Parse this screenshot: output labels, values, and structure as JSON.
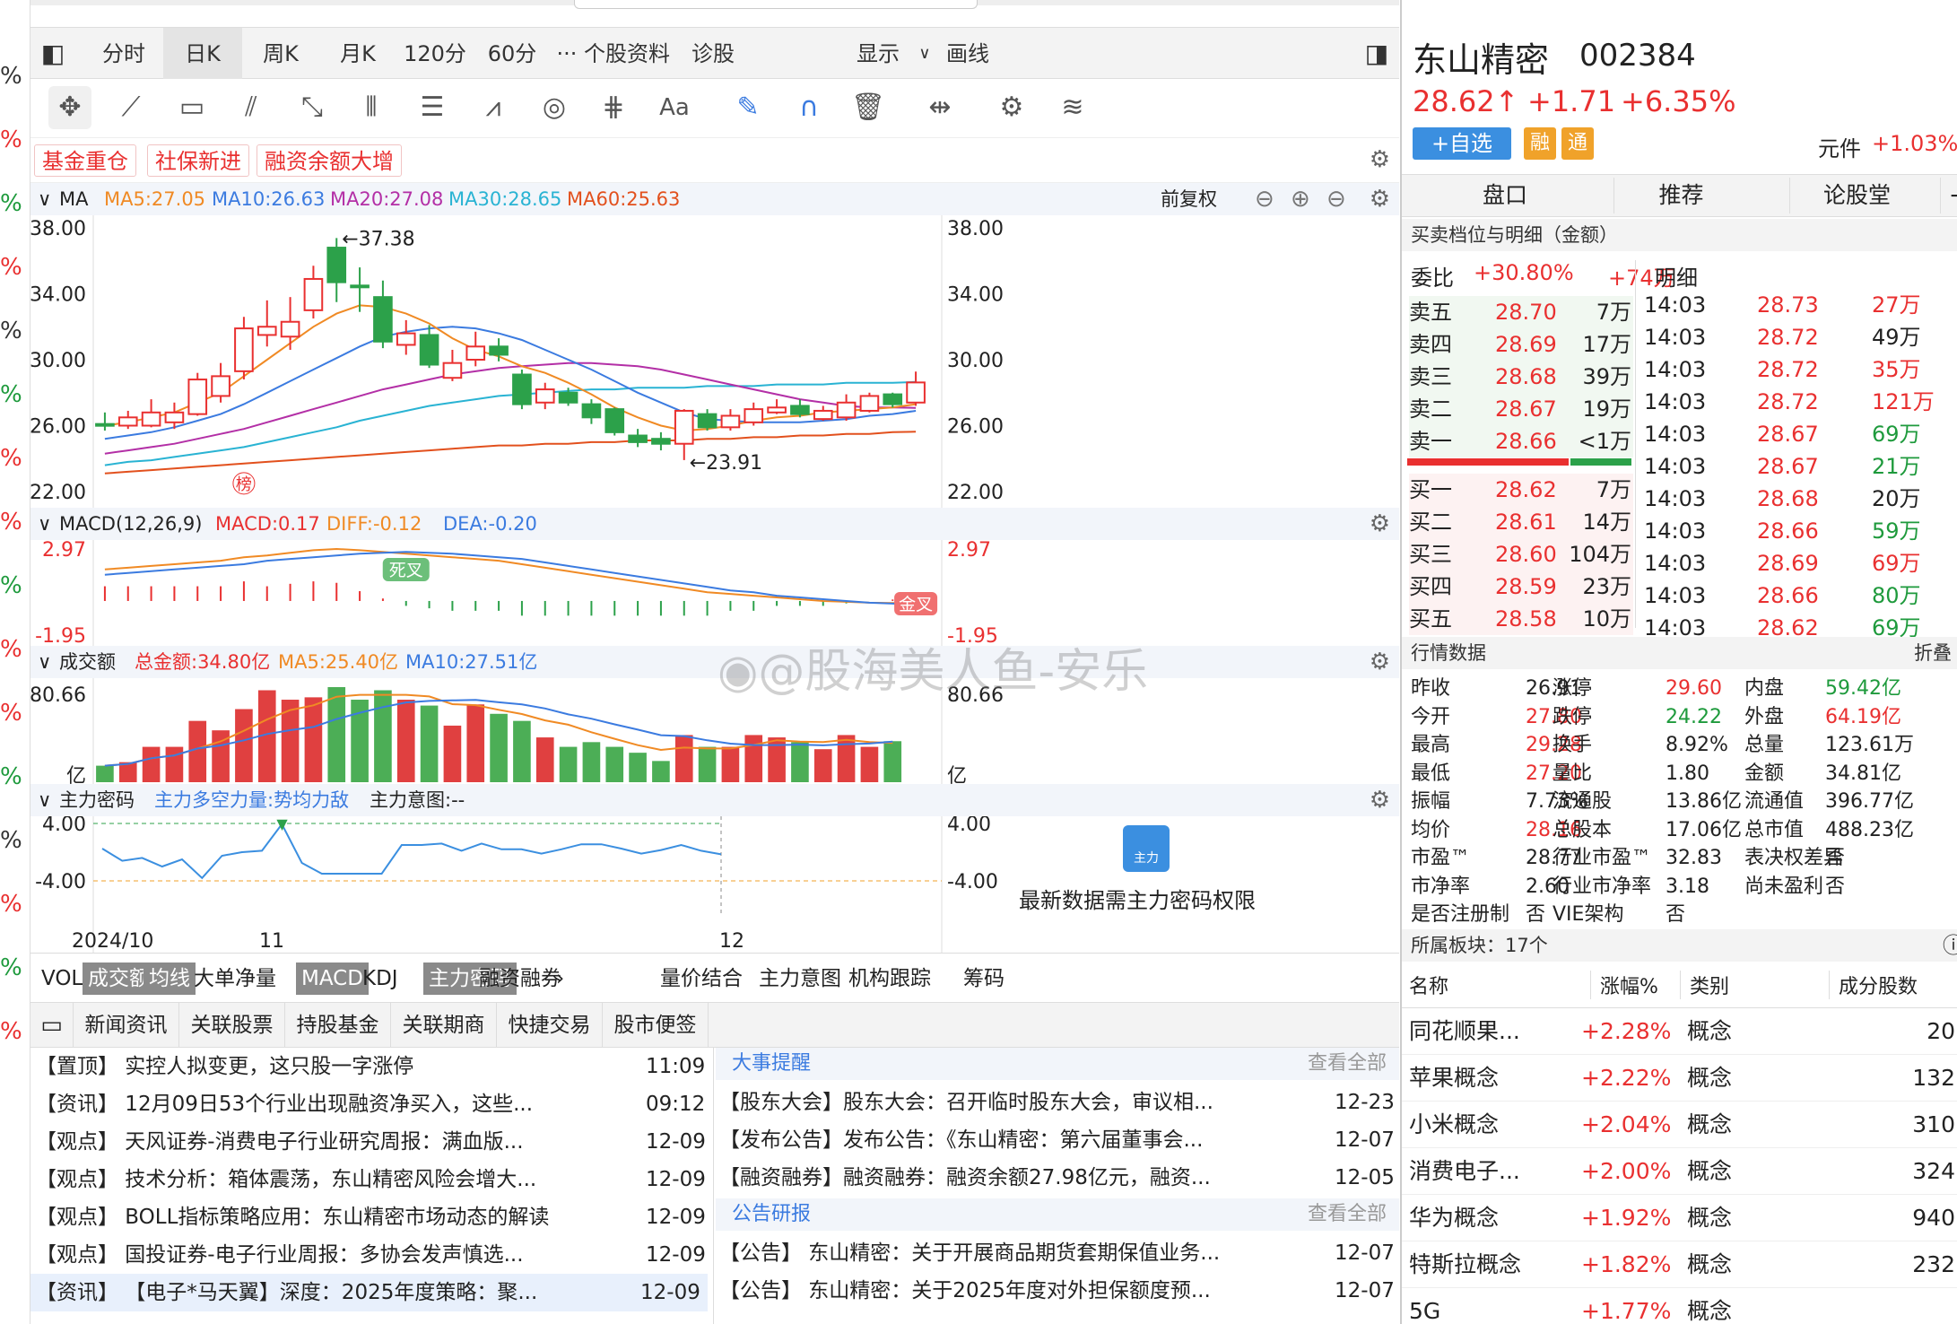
{
  "left_strip": [
    "%",
    "%",
    "%",
    "%",
    "%",
    "%",
    "%",
    "%",
    "%",
    "%",
    "%",
    "%",
    "%",
    "%",
    "%",
    "%"
  ],
  "tabs": [
    "分时",
    "日K",
    "周K",
    "月K",
    "120分",
    "60分",
    "···",
    "个股资料",
    "诊股"
  ],
  "tab_right": {
    "show": "显示",
    "draw": "画线"
  },
  "tags": [
    "基金重仓",
    "社保新进",
    "融资余额大增"
  ],
  "ma_header": {
    "title": "MA",
    "ma5": "MA5:27.05",
    "ma10": "MA10:26.63",
    "ma20": "MA20:27.08",
    "ma30": "MA30:28.65",
    "ma60": "MA60:25.63",
    "adjust": "前复权"
  },
  "price_axis": [
    "38.00",
    "34.00",
    "30.00",
    "26.00",
    "22.00"
  ],
  "price_annotations": {
    "high": "←37.38",
    "low": "←23.91",
    "badge": "榜"
  },
  "macd_header": {
    "title": "MACD(12,26,9)",
    "macd": "MACD:0.17",
    "diff": "DIFF:-0.12",
    "dea": "DEA:-0.20"
  },
  "macd_axis": {
    "top": "2.97",
    "bottom": "-1.95"
  },
  "macd_labels": {
    "dead": "死叉",
    "golden": "金叉"
  },
  "vol_header": {
    "title": "成交额",
    "total": "总金额:34.80亿",
    "ma5": "MA5:25.40亿",
    "ma10": "MA10:27.51亿"
  },
  "vol_axis": {
    "top": "80.66",
    "bottom": "亿"
  },
  "zl_header": {
    "title": "主力密码",
    "a": "主力多空力量:势均力敌",
    "b": "主力意图:--"
  },
  "zl_axis": {
    "top": "4.00",
    "bottom": "-4.00"
  },
  "zl_lock": {
    "icon_text": "主力",
    "msg": "最新数据需主力密码权限"
  },
  "x_axis": [
    "2024/10",
    "11",
    "12"
  ],
  "bottom_tabs": [
    "VOL",
    "成交额",
    "均线",
    "大单净量",
    "MACD",
    "KDJ",
    "主力密码",
    "融资融券",
    "›",
    "量价结合",
    "主力意图",
    "机构跟踪",
    "筹码"
  ],
  "news_tabs": [
    "新闻资讯",
    "关联股票",
    "持股基金",
    "关联期商",
    "快捷交易",
    "股市便签"
  ],
  "news": [
    {
      "text": "【置顶】 实控人拟变更，这只股一字涨停",
      "time": "11:09"
    },
    {
      "text": "【资讯】 12月09日53个行业出现融资净买入，这些...",
      "time": "09:12"
    },
    {
      "text": "【观点】 天风证券-消费电子行业研究周报：满血版...",
      "time": "12-09"
    },
    {
      "text": "【观点】 技术分析：箱体震荡，东山精密风险会增大...",
      "time": "12-09"
    },
    {
      "text": "【观点】 BOLL指标策略应用：东山精密市场动态的解读",
      "time": "12-09"
    },
    {
      "text": "【观点】 国投证券-电子行业周报：多协会发声慎选...",
      "time": "12-09"
    },
    {
      "text": "【资讯】 【电子*马天翼】深度：2025年度策略：聚...",
      "time": "12-09"
    }
  ],
  "events": {
    "title": "大事提醒",
    "view_all": "查看全部",
    "items": [
      {
        "text": "【股东大会】股东大会：召开临时股东大会，审议相...",
        "time": "12-23"
      },
      {
        "text": "【发布公告】发布公告：《东山精密：第六届董事会...",
        "time": "12-07"
      },
      {
        "text": "【融资融券】融资融券：融资余额27.98亿元，融资...",
        "time": "12-05"
      }
    ]
  },
  "reports": {
    "title": "公告研报",
    "view_all": "查看全部",
    "items": [
      {
        "text": "【公告】 东山精密：关于开展商品期货套期保值业务...",
        "time": "12-07"
      },
      {
        "text": "【公告】 东山精密：关于2025年度对外担保额度预...",
        "time": "12-07"
      }
    ]
  },
  "watermark": "@股海美人鱼-安乐",
  "stock": {
    "name": "东山精密",
    "code": "002384",
    "price": "28.62↑",
    "change": "+1.71",
    "pct": "+6.35%",
    "add": "+自选",
    "badge1": "融",
    "badge2": "通",
    "sector": "元件",
    "sector_pct": "+1.03%"
  },
  "right_tabs": [
    "盘口",
    "推荐",
    "论股堂",
    "+"
  ],
  "orderbook": {
    "title": "买卖档位与明细（金额）",
    "ratio_label": "委比",
    "ratio": "+30.80%",
    "ratio_amt": "+74万",
    "detail": "明细",
    "asks": [
      {
        "l": "卖五",
        "p": "28.70",
        "v": "7万"
      },
      {
        "l": "卖四",
        "p": "28.69",
        "v": "17万"
      },
      {
        "l": "卖三",
        "p": "28.68",
        "v": "39万"
      },
      {
        "l": "卖二",
        "p": "28.67",
        "v": "19万"
      },
      {
        "l": "卖一",
        "p": "28.66",
        "v": "<1万"
      }
    ],
    "bids": [
      {
        "l": "买一",
        "p": "28.62",
        "v": "7万"
      },
      {
        "l": "买二",
        "p": "28.61",
        "v": "14万"
      },
      {
        "l": "买三",
        "p": "28.60",
        "v": "104万"
      },
      {
        "l": "买四",
        "p": "28.59",
        "v": "23万"
      },
      {
        "l": "买五",
        "p": "28.58",
        "v": "10万"
      }
    ]
  },
  "ticks": [
    {
      "t": "14:03",
      "p": "28.73",
      "v": "27万",
      "c": "red"
    },
    {
      "t": "14:03",
      "p": "28.72",
      "v": "49万",
      "c": "black"
    },
    {
      "t": "14:03",
      "p": "28.72",
      "v": "35万",
      "c": "red"
    },
    {
      "t": "14:03",
      "p": "28.72",
      "v": "121万",
      "c": "red"
    },
    {
      "t": "14:03",
      "p": "28.67",
      "v": "69万",
      "c": "green"
    },
    {
      "t": "14:03",
      "p": "28.67",
      "v": "21万",
      "c": "green"
    },
    {
      "t": "14:03",
      "p": "28.68",
      "v": "20万",
      "c": "black"
    },
    {
      "t": "14:03",
      "p": "28.66",
      "v": "59万",
      "c": "green"
    },
    {
      "t": "14:03",
      "p": "28.69",
      "v": "69万",
      "c": "red"
    },
    {
      "t": "14:03",
      "p": "28.66",
      "v": "80万",
      "c": "green"
    },
    {
      "t": "14:03",
      "p": "28.62",
      "v": "69万",
      "c": "green"
    }
  ],
  "market": {
    "title": "行情数据",
    "fold": "折叠",
    "rows": [
      [
        [
          "昨收",
          "26.91",
          ""
        ],
        [
          "涨停",
          "29.60",
          "red"
        ],
        [
          "内盘",
          "59.42亿",
          "green"
        ]
      ],
      [
        [
          "今开",
          "27.80",
          "red"
        ],
        [
          "跌停",
          "24.22",
          "green"
        ],
        [
          "外盘",
          "64.19亿",
          "red"
        ]
      ],
      [
        [
          "最高",
          "29.28",
          "red"
        ],
        [
          "换手",
          "8.92%",
          ""
        ],
        [
          "总量",
          "123.61万",
          ""
        ]
      ],
      [
        [
          "最低",
          "27.20",
          "red"
        ],
        [
          "量比",
          "1.80",
          ""
        ],
        [
          "金额",
          "34.81亿",
          ""
        ]
      ],
      [
        [
          "振幅",
          "7.73%",
          ""
        ],
        [
          "流通股",
          "13.86亿",
          ""
        ],
        [
          "流通值",
          "396.77亿",
          ""
        ]
      ],
      [
        [
          "均价",
          "28.16",
          "red"
        ],
        [
          "总股本",
          "17.06亿",
          ""
        ],
        [
          "总市值",
          "488.23亿",
          ""
        ]
      ],
      [
        [
          "市盈™",
          "28.77",
          ""
        ],
        [
          "行业市盈™",
          "32.83",
          ""
        ],
        [
          "表决权差异",
          "否",
          ""
        ]
      ],
      [
        [
          "市净率",
          "2.60",
          ""
        ],
        [
          "行业市净率",
          "3.18",
          ""
        ],
        [
          "尚未盈利",
          "否",
          ""
        ]
      ],
      [
        [
          "是否注册制",
          "否",
          ""
        ],
        [
          "VIE架构",
          "否",
          ""
        ],
        [
          "",
          "",
          ""
        ]
      ]
    ]
  },
  "sectors": {
    "title": "所属板块：17个",
    "headers": [
      "名称",
      "涨幅%",
      "类别",
      "成分股数"
    ],
    "rows": [
      {
        "n": "同花顺果...",
        "p": "+2.28%",
        "c": "概念",
        "k": "20"
      },
      {
        "n": "苹果概念",
        "p": "+2.22%",
        "c": "概念",
        "k": "132"
      },
      {
        "n": "小米概念",
        "p": "+2.04%",
        "c": "概念",
        "k": "310"
      },
      {
        "n": "消费电子...",
        "p": "+2.00%",
        "c": "概念",
        "k": "324"
      },
      {
        "n": "华为概念",
        "p": "+1.92%",
        "c": "概念",
        "k": "940"
      },
      {
        "n": "特斯拉概念",
        "p": "+1.82%",
        "c": "概念",
        "k": "232"
      },
      {
        "n": "5G",
        "p": "+1.77%",
        "c": "概念",
        "k": ""
      }
    ]
  },
  "chart_data": {
    "type": "candlestick",
    "title": "",
    "ylim": [
      22,
      38
    ],
    "candles": [
      [
        26.1,
        26.0,
        26.8,
        25.7
      ],
      [
        26.0,
        26.5,
        26.9,
        25.8
      ],
      [
        26.0,
        26.8,
        27.6,
        25.9
      ],
      [
        26.2,
        26.8,
        27.4,
        25.8
      ],
      [
        26.7,
        28.8,
        29.2,
        26.6
      ],
      [
        27.8,
        29.0,
        29.8,
        27.4
      ],
      [
        29.3,
        31.9,
        32.6,
        28.8
      ],
      [
        31.5,
        32.0,
        33.6,
        30.8
      ],
      [
        31.4,
        32.3,
        33.8,
        30.6
      ],
      [
        33.0,
        34.9,
        35.7,
        32.5
      ],
      [
        36.8,
        34.7,
        37.38,
        33.5
      ],
      [
        34.5,
        34.4,
        35.6,
        32.9
      ],
      [
        33.8,
        31.1,
        34.8,
        30.7
      ],
      [
        30.9,
        31.6,
        32.4,
        30.3
      ],
      [
        31.5,
        29.7,
        32.1,
        29.5
      ],
      [
        28.9,
        29.8,
        30.6,
        28.7
      ],
      [
        30.0,
        30.8,
        31.7,
        29.6
      ],
      [
        30.8,
        30.3,
        31.3,
        29.9
      ],
      [
        29.1,
        27.3,
        29.4,
        27.0
      ],
      [
        27.4,
        28.2,
        28.6,
        27.0
      ],
      [
        28.0,
        27.4,
        28.3,
        27.2
      ],
      [
        27.3,
        26.5,
        27.6,
        26.1
      ],
      [
        27.0,
        25.6,
        27.1,
        25.4
      ],
      [
        25.4,
        25.0,
        25.8,
        24.7
      ],
      [
        25.2,
        24.9,
        25.6,
        24.5
      ],
      [
        24.9,
        26.9,
        27.0,
        23.91
      ],
      [
        26.7,
        25.9,
        27.0,
        25.7
      ],
      [
        25.9,
        26.6,
        27.0,
        25.7
      ],
      [
        26.2,
        27.0,
        27.4,
        26.0
      ],
      [
        26.8,
        27.1,
        27.6,
        26.7
      ],
      [
        27.2,
        26.7,
        27.6,
        26.5
      ],
      [
        26.4,
        26.9,
        27.2,
        26.3
      ],
      [
        26.5,
        27.4,
        27.9,
        26.3
      ],
      [
        26.9,
        27.8,
        28.0,
        26.8
      ],
      [
        27.9,
        27.3,
        28.0,
        27.1
      ],
      [
        27.4,
        28.62,
        29.28,
        27.2
      ]
    ],
    "ma5": [
      26.0,
      26.2,
      26.5,
      26.8,
      27.4,
      28.0,
      29.0,
      30.0,
      31.0,
      32.0,
      32.8,
      33.3,
      33.2,
      32.8,
      32.2,
      31.3,
      30.6,
      30.2,
      29.6,
      29.2,
      28.6,
      27.9,
      27.1,
      26.5,
      26.0,
      25.7,
      25.8,
      26.0,
      26.3,
      26.5,
      26.6,
      26.8,
      26.9,
      27.0,
      27.1,
      27.3
    ],
    "ma10": [
      25.2,
      25.4,
      25.6,
      25.9,
      26.3,
      26.7,
      27.3,
      28.0,
      28.7,
      29.4,
      30.1,
      30.8,
      31.4,
      31.7,
      31.9,
      32.0,
      31.9,
      31.6,
      31.2,
      30.6,
      30.0,
      29.4,
      28.7,
      28.0,
      27.4,
      26.8,
      26.4,
      26.3,
      26.2,
      26.2,
      26.2,
      26.3,
      26.4,
      26.6,
      26.7,
      26.9
    ],
    "ma20": [
      24.3,
      24.5,
      24.7,
      24.9,
      25.2,
      25.5,
      25.8,
      26.2,
      26.6,
      27.0,
      27.4,
      27.8,
      28.2,
      28.5,
      28.8,
      29.1,
      29.3,
      29.5,
      29.6,
      29.7,
      29.8,
      29.8,
      29.7,
      29.6,
      29.4,
      29.1,
      28.8,
      28.5,
      28.2,
      27.9,
      27.6,
      27.4,
      27.2,
      27.1,
      27.1,
      27.08
    ],
    "ma30": [
      23.6,
      23.8,
      23.9,
      24.1,
      24.3,
      24.5,
      24.7,
      25.0,
      25.3,
      25.6,
      25.9,
      26.3,
      26.6,
      26.9,
      27.2,
      27.4,
      27.6,
      27.8,
      27.9,
      28.0,
      28.1,
      28.2,
      28.2,
      28.3,
      28.3,
      28.3,
      28.4,
      28.4,
      28.4,
      28.5,
      28.5,
      28.5,
      28.6,
      28.6,
      28.6,
      28.65
    ],
    "ma60": [
      23.1,
      23.2,
      23.3,
      23.4,
      23.5,
      23.6,
      23.7,
      23.8,
      23.9,
      24.0,
      24.1,
      24.2,
      24.3,
      24.4,
      24.5,
      24.6,
      24.7,
      24.8,
      24.8,
      24.9,
      24.9,
      25.0,
      25.0,
      25.1,
      25.1,
      25.1,
      25.2,
      25.2,
      25.3,
      25.3,
      25.4,
      25.4,
      25.5,
      25.5,
      25.6,
      25.63
    ],
    "macd_ylim": [
      -1.95,
      2.97
    ],
    "diff": [
      1.8,
      1.9,
      2.0,
      2.1,
      2.2,
      2.3,
      2.5,
      2.6,
      2.75,
      2.9,
      2.97,
      2.9,
      2.8,
      2.7,
      2.6,
      2.5,
      2.4,
      2.3,
      2.1,
      1.9,
      1.7,
      1.5,
      1.3,
      1.1,
      0.9,
      0.7,
      0.5,
      0.4,
      0.3,
      0.2,
      0.1,
      0.0,
      -0.05,
      -0.1,
      -0.12,
      -0.12
    ],
    "dea": [
      1.5,
      1.6,
      1.7,
      1.8,
      1.9,
      2.0,
      2.1,
      2.3,
      2.4,
      2.5,
      2.6,
      2.7,
      2.75,
      2.8,
      2.75,
      2.7,
      2.6,
      2.5,
      2.4,
      2.2,
      2.0,
      1.8,
      1.6,
      1.4,
      1.2,
      1.0,
      0.8,
      0.6,
      0.5,
      0.3,
      0.2,
      0.1,
      0.0,
      -0.1,
      -0.15,
      -0.2
    ],
    "macd": [
      0.6,
      0.6,
      0.6,
      0.6,
      0.6,
      0.6,
      0.8,
      0.6,
      0.7,
      0.8,
      0.74,
      0.4,
      0.1,
      -0.2,
      -0.3,
      -0.4,
      -0.4,
      -0.4,
      -0.6,
      -0.6,
      -0.6,
      -0.6,
      -0.6,
      -0.6,
      -0.6,
      -0.6,
      -0.6,
      -0.4,
      -0.4,
      -0.2,
      -0.2,
      -0.2,
      -0.1,
      0.0,
      0.06,
      0.17
    ],
    "vol_ylim": [
      0,
      80.66
    ],
    "volume": [
      14,
      17,
      30,
      30,
      52,
      44,
      62,
      78,
      70,
      72,
      80.66,
      70,
      78,
      70,
      65,
      48,
      66,
      58,
      52,
      38,
      30,
      34,
      30,
      25,
      18,
      40,
      30,
      30,
      40,
      38,
      34,
      28,
      40,
      30,
      34.8
    ],
    "zl_ylim": [
      -4,
      4
    ],
    "zl": [
      0.5,
      -1.2,
      -0.8,
      -2.0,
      -1.0,
      -3.6,
      -0.5,
      0.0,
      0.2,
      3.9,
      -1.5,
      -3.0,
      -3.0,
      -3.0,
      -3.0,
      1.0,
      1.0,
      1.2,
      0.2,
      1.2,
      0.4,
      0.4,
      -0.2,
      0.4,
      1.1,
      1.1,
      0.5,
      -0.2,
      0.3,
      1.0,
      0.2,
      -0.3
    ]
  }
}
